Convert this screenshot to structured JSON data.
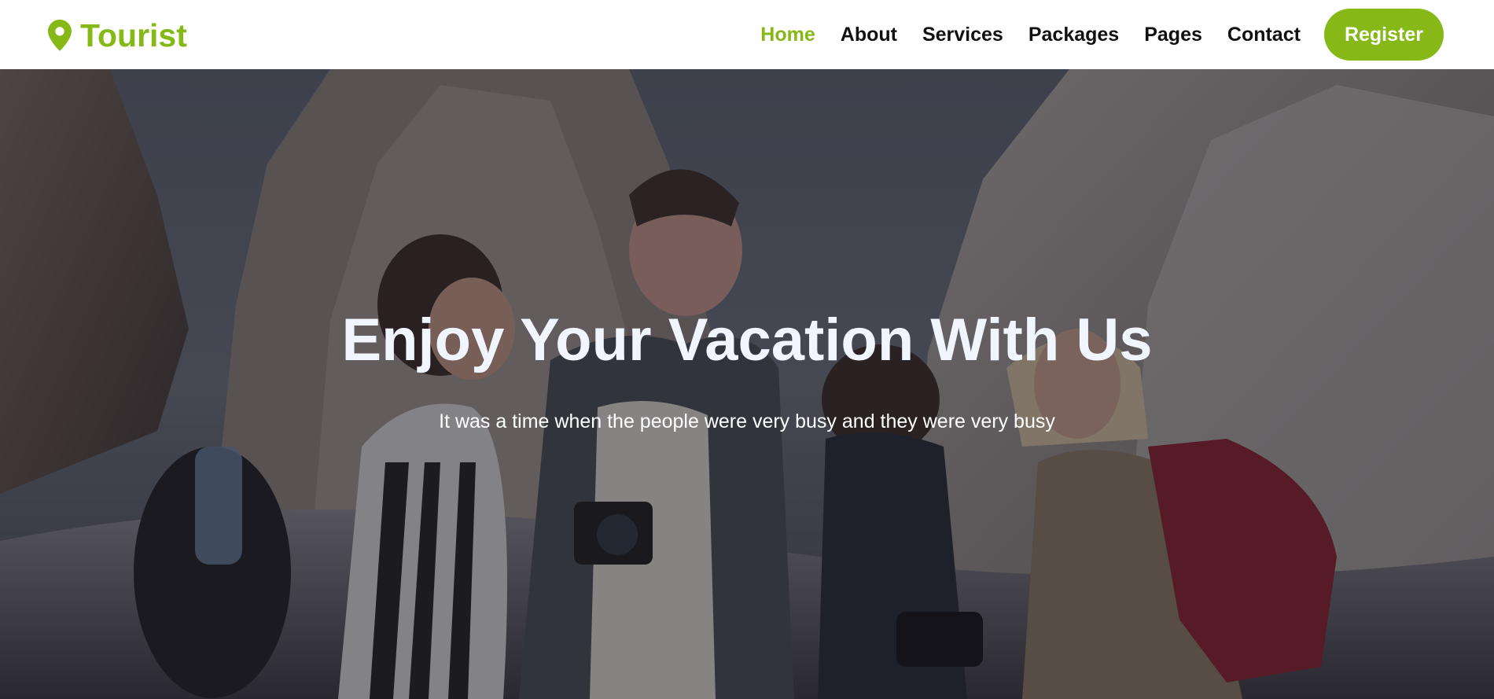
{
  "brand": {
    "name": "Tourist",
    "icon": "map-pin-icon"
  },
  "nav": {
    "items": [
      {
        "label": "Home",
        "active": true
      },
      {
        "label": "About",
        "active": false
      },
      {
        "label": "Services",
        "active": false
      },
      {
        "label": "Packages",
        "active": false
      },
      {
        "label": "Pages",
        "active": false
      },
      {
        "label": "Contact",
        "active": false
      }
    ],
    "register_label": "Register"
  },
  "hero": {
    "title": "Enjoy Your Vacation With Us",
    "subtitle": "It was a time when the people were very busy and they were very busy"
  },
  "colors": {
    "accent": "#86b817",
    "nav_text": "#111111",
    "hero_title": "#f1f5ff"
  }
}
